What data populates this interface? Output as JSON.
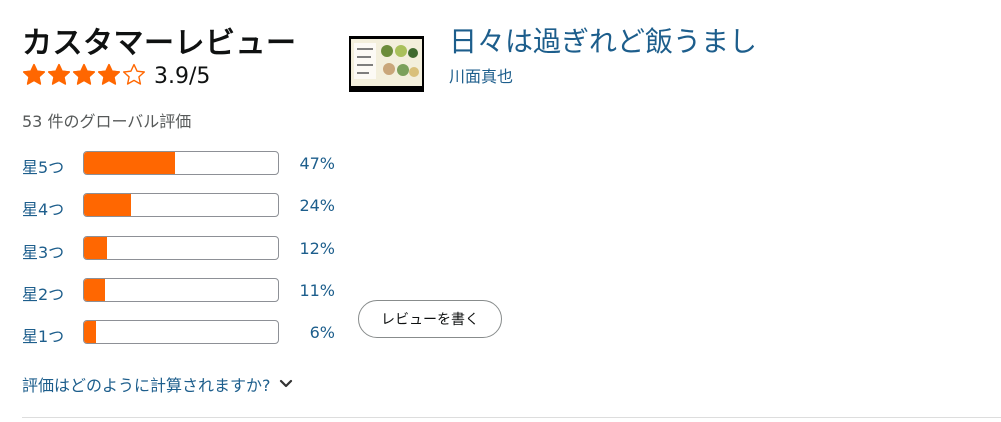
{
  "header": {
    "title": "カスタマーレビュー"
  },
  "summary": {
    "rating_value": 3.9,
    "rating_text": "3.9/5",
    "global_count_text": "53 件のグローバル評価",
    "star_color": "#ff6701"
  },
  "histogram": {
    "fill_color": "#ff6701",
    "rows": [
      {
        "label": "星5つ",
        "percent": 47,
        "percent_text": "47%"
      },
      {
        "label": "星4つ",
        "percent": 24,
        "percent_text": "24%"
      },
      {
        "label": "星3つ",
        "percent": 12,
        "percent_text": "12%"
      },
      {
        "label": "星2つ",
        "percent": 11,
        "percent_text": "11%"
      },
      {
        "label": "星1つ",
        "percent": 6,
        "percent_text": "6%"
      }
    ]
  },
  "how_link": {
    "label": "評価はどのように計算されますか?",
    "icon": "chevron-down-icon"
  },
  "product": {
    "title": "日々は過ぎれど飯うまし",
    "author": "川面真也",
    "cover_alt": "book-cover"
  },
  "write_review": {
    "label": "レビューを書く"
  }
}
